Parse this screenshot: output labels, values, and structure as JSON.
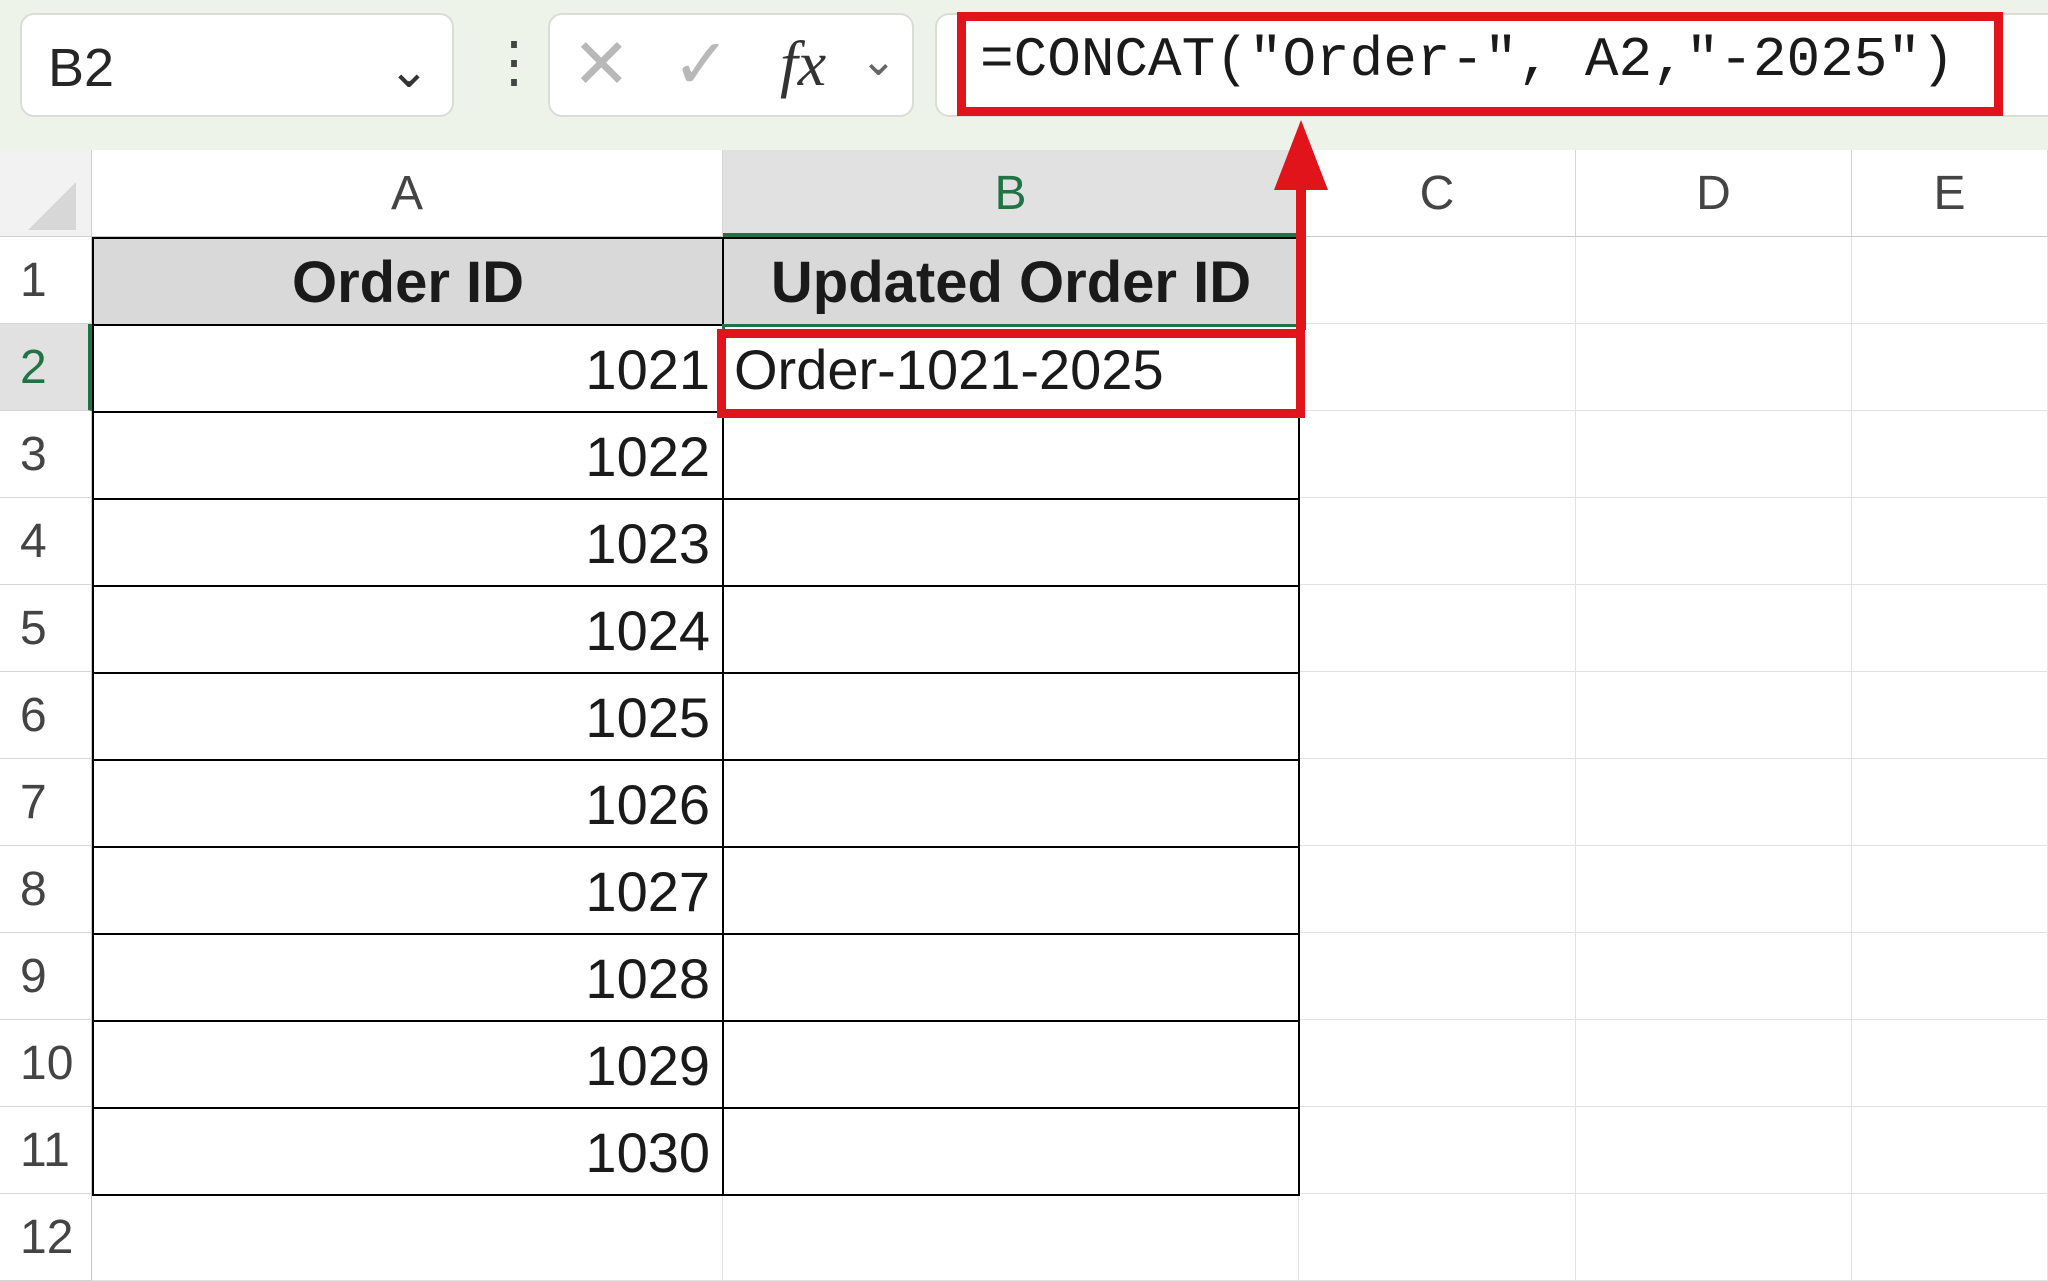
{
  "formula_bar": {
    "name_box": "B2",
    "formula": "=CONCAT(\"Order-\", A2,\"-2025\")"
  },
  "columns": [
    "A",
    "B",
    "C",
    "D",
    "E"
  ],
  "rows": [
    "1",
    "2",
    "3",
    "4",
    "5",
    "6",
    "7",
    "8",
    "9",
    "10",
    "11",
    "12"
  ],
  "sheet": {
    "header_a": "Order ID",
    "header_b": "Updated Order ID",
    "order_ids": [
      "1021",
      "1022",
      "1023",
      "1024",
      "1025",
      "1026",
      "1027",
      "1028",
      "1029",
      "1030"
    ],
    "b2_value": "Order-1021-2025"
  },
  "colors": {
    "annotation": "#e1131b",
    "excel_green": "#217346"
  }
}
